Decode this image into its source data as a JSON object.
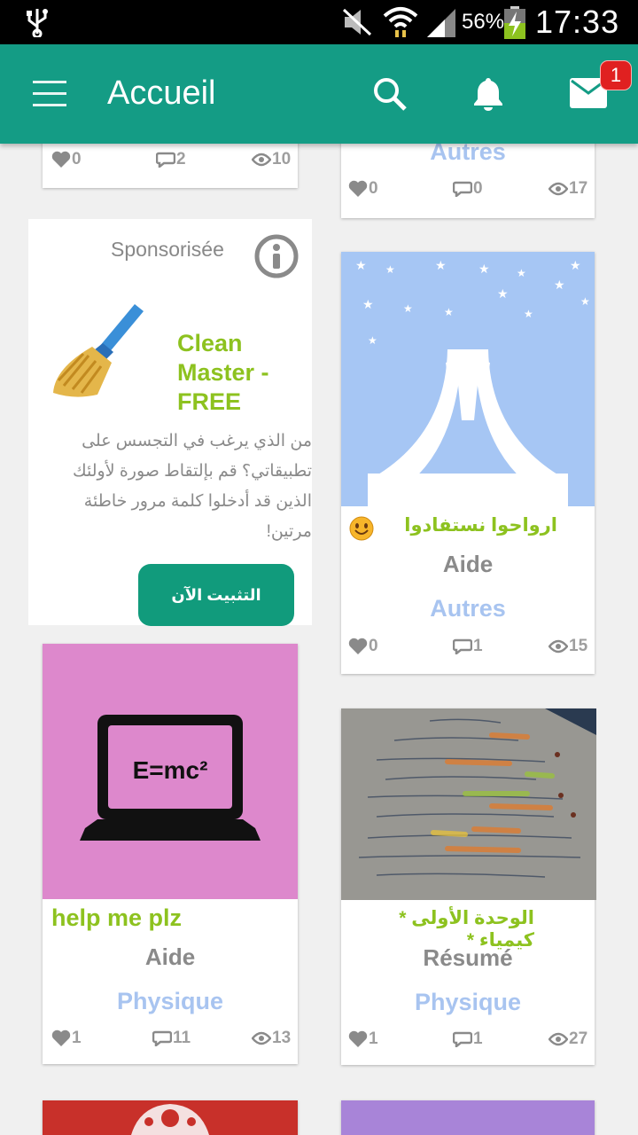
{
  "status_bar": {
    "battery_percent": "56%",
    "time": "17:33",
    "icons": [
      "usb-icon",
      "mute-icon",
      "wifi-icon",
      "signal-icon",
      "battery-charging-icon"
    ]
  },
  "app_bar": {
    "title": "Accueil",
    "mail_badge": "1",
    "icons": [
      "menu-icon",
      "search-icon",
      "bell-icon",
      "mail-icon"
    ]
  },
  "colors": {
    "primary": "#149c85",
    "title_green": "#8dc21f",
    "category_blue": "#a8c4f0",
    "install_button": "#119b7c"
  },
  "cards": {
    "top_left": {
      "likes": "0",
      "comments": "2",
      "views": "10"
    },
    "top_right": {
      "category": "Autres",
      "likes": "0",
      "comments": "0",
      "views": "17"
    },
    "sponsored": {
      "label": "Sponsorisée",
      "app_name": "Clean Master - FREE",
      "description": "من الذي يرغب في التجسس على تطبيقاتي؟  قم بإلتقاط صورة لأولئك الذين قد أدخلوا كلمة مرور خاطئة مرتين!",
      "button": "التثبيت الآن"
    },
    "monument": {
      "title": "ارواحوا نستفادوا",
      "type": "Aide",
      "category": "Autres",
      "likes": "0",
      "comments": "1",
      "views": "15"
    },
    "emc2": {
      "image_text": "E=mc²",
      "title": "help me plz",
      "type": "Aide",
      "category": "Physique",
      "likes": "1",
      "comments": "11",
      "views": "13"
    },
    "notes": {
      "title": "الوحدة الأولى * كيمياء *",
      "type": "Résumé",
      "category": "Physique",
      "likes": "1",
      "comments": "1",
      "views": "27"
    }
  }
}
